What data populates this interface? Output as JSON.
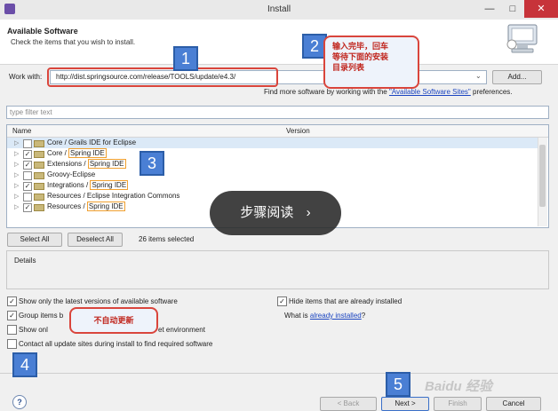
{
  "window": {
    "title": "Install",
    "minimize": "—",
    "maximize": "□",
    "close": "✕"
  },
  "header": {
    "title": "Available Software",
    "subtitle": "Check the items that you wish to install."
  },
  "work_with": {
    "label": "Work with:",
    "value": "http://dist.springsource.com/release/TOOLS/update/e4.3/",
    "add_label": "Add...",
    "find_prefix": "Find more software by working with the",
    "find_link": "\"Available Software Sites\"",
    "find_suffix": "preferences."
  },
  "filter": {
    "placeholder": "type filter text"
  },
  "table": {
    "columns": [
      "Name",
      "Version"
    ],
    "rows": [
      {
        "checked": false,
        "name": "Core / Grails IDE for Eclipse",
        "suffix": ""
      },
      {
        "checked": true,
        "name": "Core / ",
        "suffix": "Spring IDE"
      },
      {
        "checked": true,
        "name": "Extensions / ",
        "suffix": "Spring IDE"
      },
      {
        "checked": false,
        "name": "Groovy-Eclipse",
        "suffix": ""
      },
      {
        "checked": true,
        "name": "Integrations / ",
        "suffix": "Spring IDE"
      },
      {
        "checked": false,
        "name": "Resources / Eclipse Integration Commons",
        "suffix": ""
      },
      {
        "checked": true,
        "name": "Resources / ",
        "suffix": "Spring IDE"
      }
    ]
  },
  "selection": {
    "select_all": "Select All",
    "deselect_all": "Deselect All",
    "count": "26 items selected"
  },
  "details": {
    "label": "Details"
  },
  "options": {
    "latest": "Show only the latest versions of available software",
    "group": "Group items b",
    "show_only": "Show onl",
    "show_only_tail": "et environment",
    "contact": "Contact all update sites during install to find required software",
    "hide": "Hide items that are already installed",
    "what_is": "What is",
    "already_installed": "already installed",
    "what_is_tail": "?"
  },
  "footer": {
    "help": "?",
    "back": "< Back",
    "next": "Next >",
    "finish": "Finish",
    "cancel": "Cancel"
  },
  "annotations": {
    "n1": "1",
    "n2": "2",
    "n3": "3",
    "n4": "4",
    "n5": "5",
    "bubble2": [
      "输入完毕，回车",
      "等待下面的安装",
      "目录列表"
    ],
    "bubble4": "不自动更新"
  },
  "overlay": {
    "text": "步骤阅读",
    "arrow": "›"
  },
  "watermark": "Baidu 经验",
  "colors": {
    "accent": "#4a7fd4",
    "callout_border": "#d9453c",
    "highlight": "#f0a030"
  }
}
